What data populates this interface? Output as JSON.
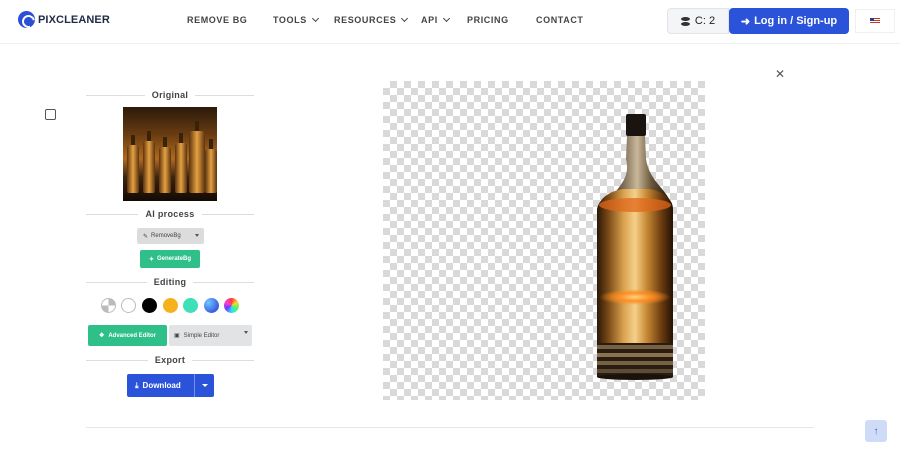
{
  "brand": {
    "name": "PIXCLEANER"
  },
  "nav": {
    "items": [
      {
        "label": "REMOVE BG",
        "has_dropdown": false
      },
      {
        "label": "TOOLS",
        "has_dropdown": true
      },
      {
        "label": "RESOURCES",
        "has_dropdown": true
      },
      {
        "label": "API",
        "has_dropdown": true
      },
      {
        "label": "PRICING",
        "has_dropdown": false
      },
      {
        "label": "CONTACT",
        "has_dropdown": false
      }
    ],
    "credits_label": "C: 2",
    "login_label": "Log in / Sign-up",
    "language_flag": "us-flag-icon"
  },
  "panel": {
    "original_title": "Original",
    "ai_title": "AI process",
    "removebg_label": "RemoveBg",
    "generatebg_label": "GenerateBg",
    "editing_title": "Editing",
    "swatches": [
      {
        "name": "transparent-swatch",
        "color": "checker"
      },
      {
        "name": "white-swatch",
        "color": "#ffffff"
      },
      {
        "name": "black-swatch",
        "color": "#000000"
      },
      {
        "name": "orange-swatch",
        "color": "#f5b21c"
      },
      {
        "name": "teal-swatch",
        "color": "#3fe0b8"
      },
      {
        "name": "blue-gradient-swatch",
        "color": "gradient"
      },
      {
        "name": "rainbow-swatch",
        "color": "conic"
      }
    ],
    "advanced_editor_label": "Advanced Editor",
    "simple_editor_label": "Simple Editor",
    "export_title": "Export",
    "download_label": "Download"
  },
  "colors": {
    "primary_blue": "#2b53d9",
    "accent_green": "#2fc08a"
  }
}
